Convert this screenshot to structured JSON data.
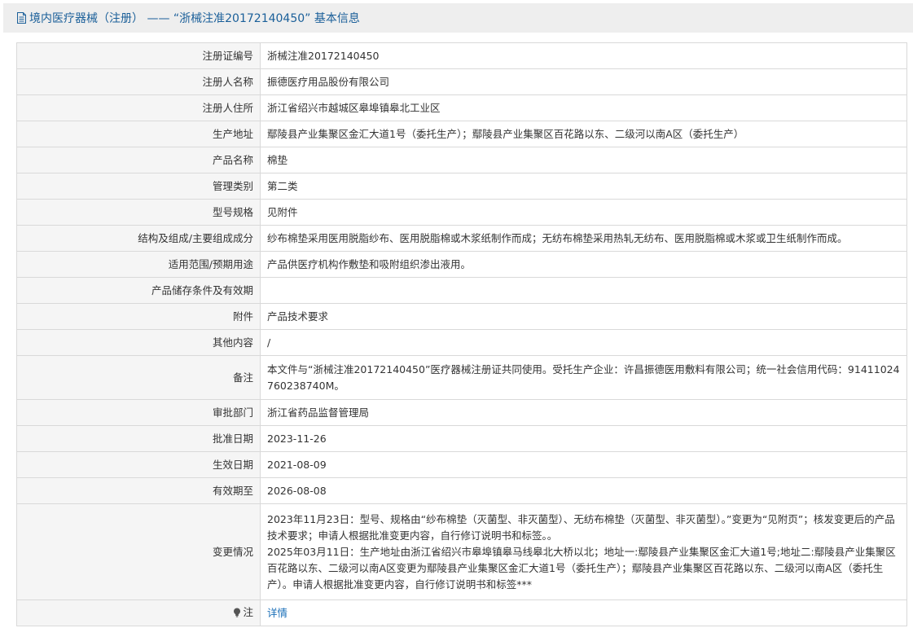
{
  "header": {
    "title": "境内医疗器械（注册） —— “浙械注准20172140450” 基本信息",
    "icon": "document-icon"
  },
  "rows": [
    {
      "label": "注册证编号",
      "value": "浙械注准20172140450"
    },
    {
      "label": "注册人名称",
      "value": "振德医疗用品股份有限公司"
    },
    {
      "label": "注册人住所",
      "value": "浙江省绍兴市越城区皋埠镇皋北工业区"
    },
    {
      "label": "生产地址",
      "value": "鄢陵县产业集聚区金汇大道1号（委托生产）；鄢陵县产业集聚区百花路以东、二级河以南A区（委托生产）"
    },
    {
      "label": "产品名称",
      "value": "棉垫"
    },
    {
      "label": "管理类别",
      "value": "第二类"
    },
    {
      "label": "型号规格",
      "value": "见附件"
    },
    {
      "label": "结构及组成/主要组成成分",
      "value": "纱布棉垫采用医用脱脂纱布、医用脱脂棉或木浆纸制作而成；无纺布棉垫采用热轧无纺布、医用脱脂棉或木浆或卫生纸制作而成。"
    },
    {
      "label": "适用范围/预期用途",
      "value": "产品供医疗机构作敷垫和吸附组织渗出液用。"
    },
    {
      "label": "产品储存条件及有效期",
      "value": ""
    },
    {
      "label": "附件",
      "value": "产品技术要求"
    },
    {
      "label": "其他内容",
      "value": "/"
    },
    {
      "label": "备注",
      "value": "本文件与“浙械注准20172140450”医疗器械注册证共同使用。受托生产企业：许昌振德医用敷料有限公司；统一社会信用代码：91411024760238740M。"
    },
    {
      "label": "审批部门",
      "value": "浙江省药品监督管理局"
    },
    {
      "label": "批准日期",
      "value": "2023-11-26"
    },
    {
      "label": "生效日期",
      "value": "2021-08-09"
    },
    {
      "label": "有效期至",
      "value": "2026-08-08"
    }
  ],
  "changes": {
    "label": "变更情况",
    "paragraphs": [
      "2023年11月23日：型号、规格由“纱布棉垫（灭菌型、非灭菌型）、无纺布棉垫（灭菌型、非灭菌型）。”变更为“见附页”；核发变更后的产品技术要求；申请人根据批准变更内容，自行修订说明书和标签。。",
      "2025年03月11日：生产地址由浙江省绍兴市皋埠镇皋马线皋北大桥以北；地址一:鄢陵县产业集聚区金汇大道1号;地址二:鄢陵县产业集聚区百花路以东、二级河以南A区变更为鄢陵县产业集聚区金汇大道1号（委托生产）；鄢陵县产业集聚区百花路以东、二级河以南A区（委托生产）。申请人根据批准变更内容，自行修订说明书和标签***"
    ]
  },
  "note": {
    "label": "注",
    "icon": "lightbulb-icon",
    "link_text": "详情"
  },
  "colors": {
    "title": "#1a5f99",
    "link": "#1a6fb8",
    "label_bg": "#f5f5f5",
    "header_bg": "#eeeeee",
    "border": "#d9d9d9"
  }
}
